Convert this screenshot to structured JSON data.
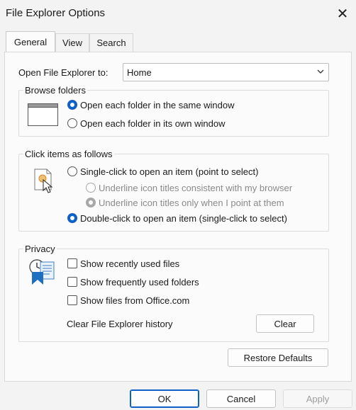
{
  "window": {
    "title": "File Explorer Options",
    "close_glyph": "✕"
  },
  "tabs": [
    {
      "label": "General"
    },
    {
      "label": "View"
    },
    {
      "label": "Search"
    }
  ],
  "open_to": {
    "label": "Open File Explorer to:",
    "value": "Home"
  },
  "browse": {
    "legend": "Browse folders",
    "same_window": "Open each folder in the same window",
    "own_window": "Open each folder in its own window"
  },
  "click": {
    "legend": "Click items as follows",
    "single": "Single-click to open an item (point to select)",
    "underline_browser": "Underline icon titles consistent with my browser",
    "underline_point": "Underline icon titles only when I point at them",
    "double": "Double-click to open an item (single-click to select)"
  },
  "privacy": {
    "legend": "Privacy",
    "recent": "Show recently used files",
    "frequent": "Show frequently used folders",
    "office": "Show files from Office.com",
    "clear_label": "Clear File Explorer history",
    "clear_button": "Clear"
  },
  "restore_button": "Restore Defaults",
  "footer": {
    "ok": "OK",
    "cancel": "Cancel",
    "apply": "Apply"
  },
  "accent_color": "#0f61c9"
}
